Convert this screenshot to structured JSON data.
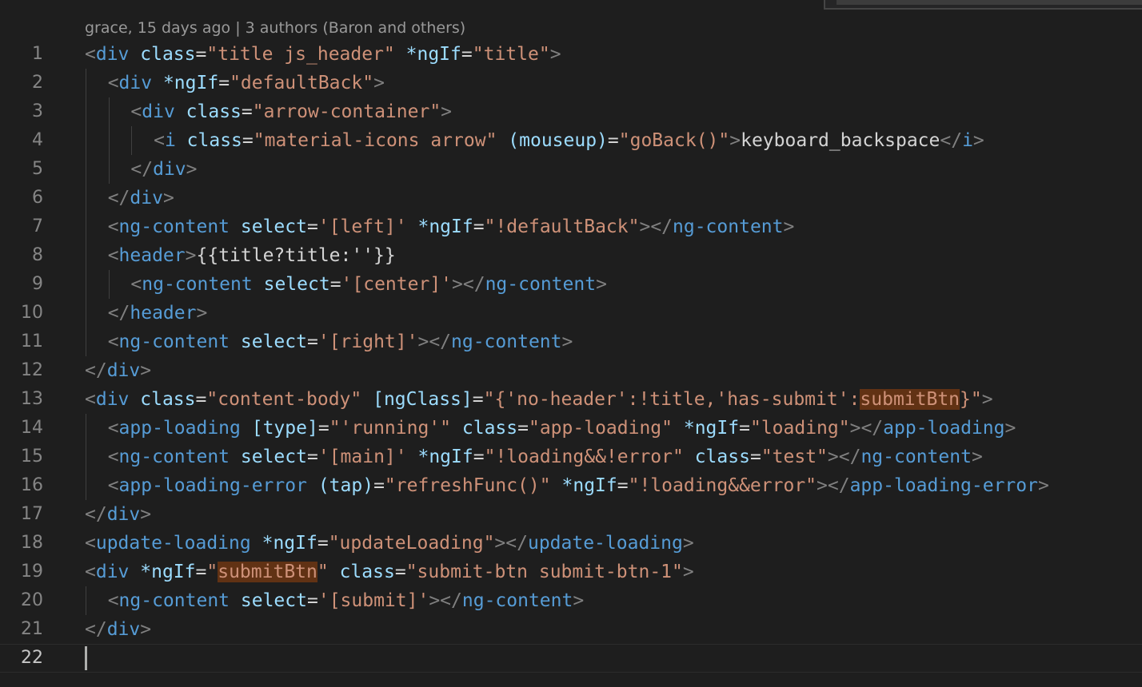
{
  "codelens": {
    "text": "grace, 15 days ago | 3 authors (Baron and others)"
  },
  "colors": {
    "background": "#1e1e1e",
    "tag": "#569cd6",
    "punctuation": "#808080",
    "attribute": "#9cdcfe",
    "string": "#ce9178",
    "text": "#d4d4d4",
    "highlight": "#613214"
  },
  "editor": {
    "current_line": 22,
    "lines": [
      {
        "number": "1",
        "indent": 0,
        "tokens": [
          [
            "p",
            "<"
          ],
          [
            "t",
            "div"
          ],
          [
            "x",
            " "
          ],
          [
            "a",
            "class"
          ],
          [
            "x",
            "="
          ],
          [
            "s",
            "\"title js_header\""
          ],
          [
            "x",
            " "
          ],
          [
            "a",
            "*ngIf"
          ],
          [
            "x",
            "="
          ],
          [
            "s",
            "\"title\""
          ],
          [
            "p",
            ">"
          ]
        ]
      },
      {
        "number": "2",
        "indent": 1,
        "tokens": [
          [
            "p",
            "<"
          ],
          [
            "t",
            "div"
          ],
          [
            "x",
            " "
          ],
          [
            "a",
            "*ngIf"
          ],
          [
            "x",
            "="
          ],
          [
            "s",
            "\"defaultBack\""
          ],
          [
            "p",
            ">"
          ]
        ]
      },
      {
        "number": "3",
        "indent": 2,
        "tokens": [
          [
            "p",
            "<"
          ],
          [
            "t",
            "div"
          ],
          [
            "x",
            " "
          ],
          [
            "a",
            "class"
          ],
          [
            "x",
            "="
          ],
          [
            "s",
            "\"arrow-container\""
          ],
          [
            "p",
            ">"
          ]
        ]
      },
      {
        "number": "4",
        "indent": 3,
        "tokens": [
          [
            "p",
            "<"
          ],
          [
            "t",
            "i"
          ],
          [
            "x",
            " "
          ],
          [
            "a",
            "class"
          ],
          [
            "x",
            "="
          ],
          [
            "s",
            "\"material-icons arrow\""
          ],
          [
            "x",
            " "
          ],
          [
            "a",
            "(mouseup)"
          ],
          [
            "x",
            "="
          ],
          [
            "s",
            "\"goBack()\""
          ],
          [
            "p",
            ">"
          ],
          [
            "x",
            "keyboard_backspace"
          ],
          [
            "p",
            "</"
          ],
          [
            "t",
            "i"
          ],
          [
            "p",
            ">"
          ]
        ]
      },
      {
        "number": "5",
        "indent": 2,
        "tokens": [
          [
            "p",
            "</"
          ],
          [
            "t",
            "div"
          ],
          [
            "p",
            ">"
          ]
        ]
      },
      {
        "number": "6",
        "indent": 1,
        "tokens": [
          [
            "p",
            "</"
          ],
          [
            "t",
            "div"
          ],
          [
            "p",
            ">"
          ]
        ]
      },
      {
        "number": "7",
        "indent": 1,
        "tokens": [
          [
            "p",
            "<"
          ],
          [
            "t",
            "ng-content"
          ],
          [
            "x",
            " "
          ],
          [
            "a",
            "select"
          ],
          [
            "x",
            "="
          ],
          [
            "s",
            "'[left]'"
          ],
          [
            "x",
            " "
          ],
          [
            "a",
            "*ngIf"
          ],
          [
            "x",
            "="
          ],
          [
            "s",
            "\"!defaultBack\""
          ],
          [
            "p",
            "></"
          ],
          [
            "t",
            "ng-content"
          ],
          [
            "p",
            ">"
          ]
        ]
      },
      {
        "number": "8",
        "indent": 1,
        "tokens": [
          [
            "p",
            "<"
          ],
          [
            "t",
            "header"
          ],
          [
            "p",
            ">"
          ],
          [
            "x",
            "{{title?title:''}}"
          ]
        ]
      },
      {
        "number": "9",
        "indent": 2,
        "tokens": [
          [
            "p",
            "<"
          ],
          [
            "t",
            "ng-content"
          ],
          [
            "x",
            " "
          ],
          [
            "a",
            "select"
          ],
          [
            "x",
            "="
          ],
          [
            "s",
            "'[center]'"
          ],
          [
            "p",
            "></"
          ],
          [
            "t",
            "ng-content"
          ],
          [
            "p",
            ">"
          ]
        ]
      },
      {
        "number": "10",
        "indent": 1,
        "tokens": [
          [
            "p",
            "</"
          ],
          [
            "t",
            "header"
          ],
          [
            "p",
            ">"
          ]
        ]
      },
      {
        "number": "11",
        "indent": 1,
        "tokens": [
          [
            "p",
            "<"
          ],
          [
            "t",
            "ng-content"
          ],
          [
            "x",
            " "
          ],
          [
            "a",
            "select"
          ],
          [
            "x",
            "="
          ],
          [
            "s",
            "'[right]'"
          ],
          [
            "p",
            "></"
          ],
          [
            "t",
            "ng-content"
          ],
          [
            "p",
            ">"
          ]
        ]
      },
      {
        "number": "12",
        "indent": 0,
        "tokens": [
          [
            "p",
            "</"
          ],
          [
            "t",
            "div"
          ],
          [
            "p",
            ">"
          ]
        ]
      },
      {
        "number": "13",
        "indent": 0,
        "tokens": [
          [
            "p",
            "<"
          ],
          [
            "t",
            "div"
          ],
          [
            "x",
            " "
          ],
          [
            "a",
            "class"
          ],
          [
            "x",
            "="
          ],
          [
            "s",
            "\"content-body\""
          ],
          [
            "x",
            " "
          ],
          [
            "a",
            "[ngClass]"
          ],
          [
            "x",
            "="
          ],
          [
            "s",
            "\"{'no-header':!title,'has-submit':"
          ],
          [
            "sh",
            "submitBtn"
          ],
          [
            "s",
            "}\""
          ],
          [
            "p",
            ">"
          ]
        ]
      },
      {
        "number": "14",
        "indent": 1,
        "tokens": [
          [
            "p",
            "<"
          ],
          [
            "t",
            "app-loading"
          ],
          [
            "x",
            " "
          ],
          [
            "a",
            "[type]"
          ],
          [
            "x",
            "="
          ],
          [
            "s",
            "\"'running'\""
          ],
          [
            "x",
            " "
          ],
          [
            "a",
            "class"
          ],
          [
            "x",
            "="
          ],
          [
            "s",
            "\"app-loading\""
          ],
          [
            "x",
            " "
          ],
          [
            "a",
            "*ngIf"
          ],
          [
            "x",
            "="
          ],
          [
            "s",
            "\"loading\""
          ],
          [
            "p",
            "></"
          ],
          [
            "t",
            "app-loading"
          ],
          [
            "p",
            ">"
          ]
        ]
      },
      {
        "number": "15",
        "indent": 1,
        "tokens": [
          [
            "p",
            "<"
          ],
          [
            "t",
            "ng-content"
          ],
          [
            "x",
            " "
          ],
          [
            "a",
            "select"
          ],
          [
            "x",
            "="
          ],
          [
            "s",
            "'[main]'"
          ],
          [
            "x",
            " "
          ],
          [
            "a",
            "*ngIf"
          ],
          [
            "x",
            "="
          ],
          [
            "s",
            "\"!loading&&!error\""
          ],
          [
            "x",
            " "
          ],
          [
            "a",
            "class"
          ],
          [
            "x",
            "="
          ],
          [
            "s",
            "\"test\""
          ],
          [
            "p",
            "></"
          ],
          [
            "t",
            "ng-content"
          ],
          [
            "p",
            ">"
          ]
        ]
      },
      {
        "number": "16",
        "indent": 1,
        "tokens": [
          [
            "p",
            "<"
          ],
          [
            "t",
            "app-loading-error"
          ],
          [
            "x",
            " "
          ],
          [
            "a",
            "(tap)"
          ],
          [
            "x",
            "="
          ],
          [
            "s",
            "\"refreshFunc()\""
          ],
          [
            "x",
            " "
          ],
          [
            "a",
            "*ngIf"
          ],
          [
            "x",
            "="
          ],
          [
            "s",
            "\"!loading&&error\""
          ],
          [
            "p",
            "></"
          ],
          [
            "t",
            "app-loading-error"
          ],
          [
            "p",
            ">"
          ]
        ]
      },
      {
        "number": "17",
        "indent": 0,
        "tokens": [
          [
            "p",
            "</"
          ],
          [
            "t",
            "div"
          ],
          [
            "p",
            ">"
          ]
        ]
      },
      {
        "number": "18",
        "indent": 0,
        "tokens": [
          [
            "p",
            "<"
          ],
          [
            "t",
            "update-loading"
          ],
          [
            "x",
            " "
          ],
          [
            "a",
            "*ngIf"
          ],
          [
            "x",
            "="
          ],
          [
            "s",
            "\"updateLoading\""
          ],
          [
            "p",
            "></"
          ],
          [
            "t",
            "update-loading"
          ],
          [
            "p",
            ">"
          ]
        ]
      },
      {
        "number": "19",
        "indent": 0,
        "tokens": [
          [
            "p",
            "<"
          ],
          [
            "t",
            "div"
          ],
          [
            "x",
            " "
          ],
          [
            "a",
            "*ngIf"
          ],
          [
            "x",
            "="
          ],
          [
            "s",
            "\""
          ],
          [
            "sh",
            "submitBtn"
          ],
          [
            "s",
            "\""
          ],
          [
            "x",
            " "
          ],
          [
            "a",
            "class"
          ],
          [
            "x",
            "="
          ],
          [
            "s",
            "\"submit-btn submit-btn-1\""
          ],
          [
            "p",
            ">"
          ]
        ]
      },
      {
        "number": "20",
        "indent": 1,
        "tokens": [
          [
            "p",
            "<"
          ],
          [
            "t",
            "ng-content"
          ],
          [
            "x",
            " "
          ],
          [
            "a",
            "select"
          ],
          [
            "x",
            "="
          ],
          [
            "s",
            "'[submit]'"
          ],
          [
            "p",
            "></"
          ],
          [
            "t",
            "ng-content"
          ],
          [
            "p",
            ">"
          ]
        ]
      },
      {
        "number": "21",
        "indent": 0,
        "tokens": [
          [
            "p",
            "</"
          ],
          [
            "t",
            "div"
          ],
          [
            "p",
            ">"
          ]
        ]
      },
      {
        "number": "22",
        "indent": 0,
        "tokens": []
      }
    ]
  }
}
